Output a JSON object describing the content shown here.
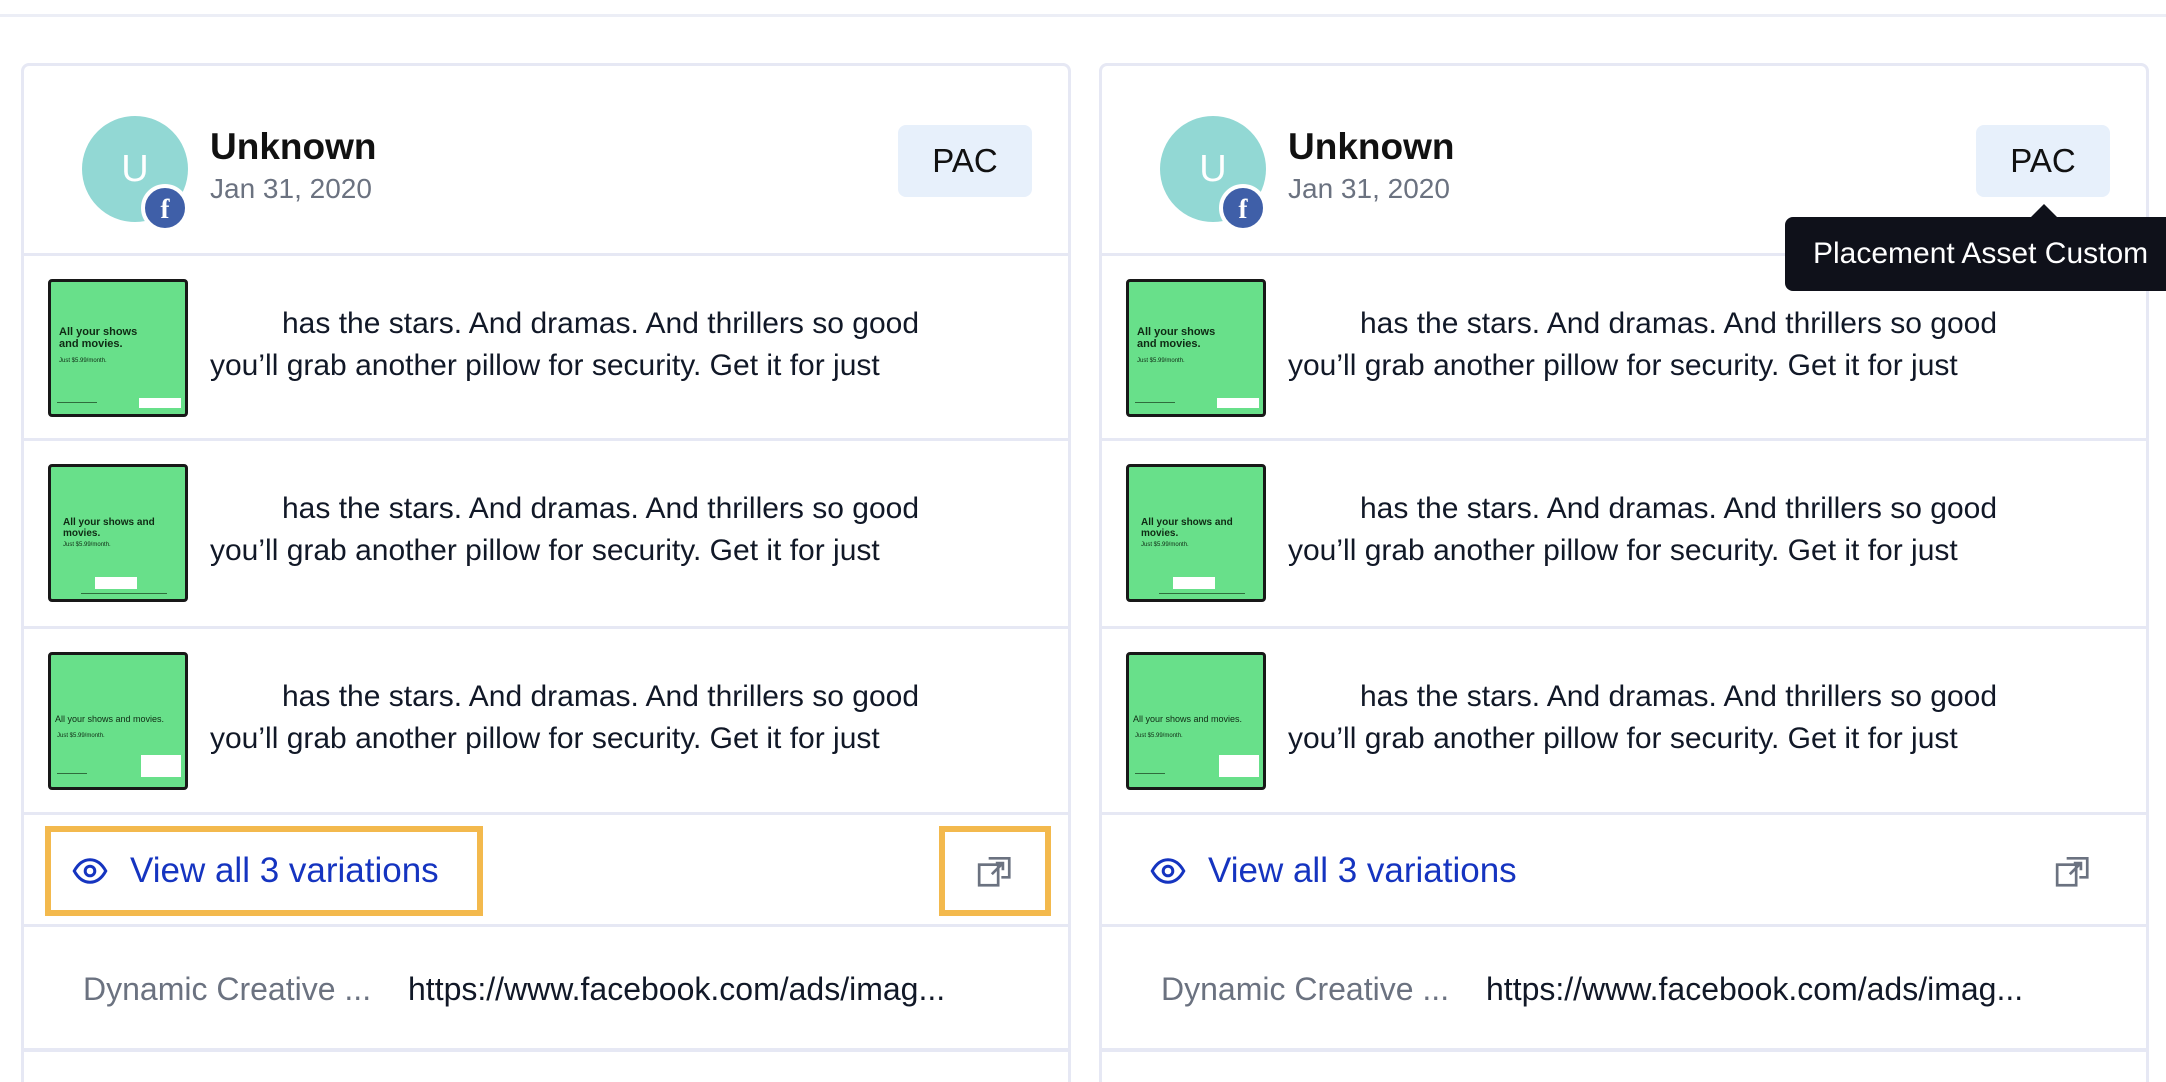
{
  "cards": [
    {
      "author": "Unknown",
      "avatar_initial": "U",
      "platform_badge": "f",
      "date": "Jan 31, 2020",
      "badge": "PAC",
      "variations": [
        {
          "thumb_headline": "All your shows and movies.",
          "thumb_sub": "Just $5.99/month.",
          "text_line1": "has the stars. And dramas. And thrillers so good",
          "text_line2": "you’ll grab another pillow for security. Get it for just"
        },
        {
          "thumb_headline": "All your shows and movies.",
          "thumb_sub": "Just $5.99/month.",
          "text_line1": "has the stars. And dramas. And thrillers so good",
          "text_line2": "you’ll grab another pillow for security. Get it for just"
        },
        {
          "thumb_headline": "All your shows and movies.",
          "thumb_sub": "Just $5.99/month.",
          "text_line1": "has the stars. And dramas. And thrillers so good",
          "text_line2": "you’ll grab another pillow for security. Get it for just"
        }
      ],
      "view_all_label": "View all 3 variations",
      "meta_label": "Dynamic Creative ...",
      "meta_link": "https://www.facebook.com/ads/imag..."
    },
    {
      "author": "Unknown",
      "avatar_initial": "U",
      "platform_badge": "f",
      "date": "Jan 31, 2020",
      "badge": "PAC",
      "variations": [
        {
          "thumb_headline": "All your shows and movies.",
          "thumb_sub": "Just $5.99/month.",
          "text_line1": "has the stars. And dramas. And thrillers so good",
          "text_line2": "you’ll grab another pillow for security. Get it for just"
        },
        {
          "thumb_headline": "All your shows and movies.",
          "thumb_sub": "Just $5.99/month.",
          "text_line1": "has the stars. And dramas. And thrillers so good",
          "text_line2": "you’ll grab another pillow for security. Get it for just"
        },
        {
          "thumb_headline": "All your shows and movies.",
          "thumb_sub": "Just $5.99/month.",
          "text_line1": "has the stars. And dramas. And thrillers so good",
          "text_line2": "you’ll grab another pillow for security. Get it for just"
        }
      ],
      "view_all_label": "View all 3 variations",
      "meta_label": "Dynamic Creative ...",
      "meta_link": "https://www.facebook.com/ads/imag..."
    }
  ],
  "tooltip": {
    "text": "Placement Asset Custom"
  },
  "colors": {
    "link": "#1534c0",
    "highlight": "#f3b94d",
    "thumb_bg": "#68e08a",
    "avatar_bg": "#92d8d4",
    "badge_bg": "#e7f0fb",
    "facebook": "#3f5fa8"
  },
  "icons": {
    "view_all": "eye-icon",
    "open": "external-link-icon",
    "platform": "facebook-icon"
  }
}
